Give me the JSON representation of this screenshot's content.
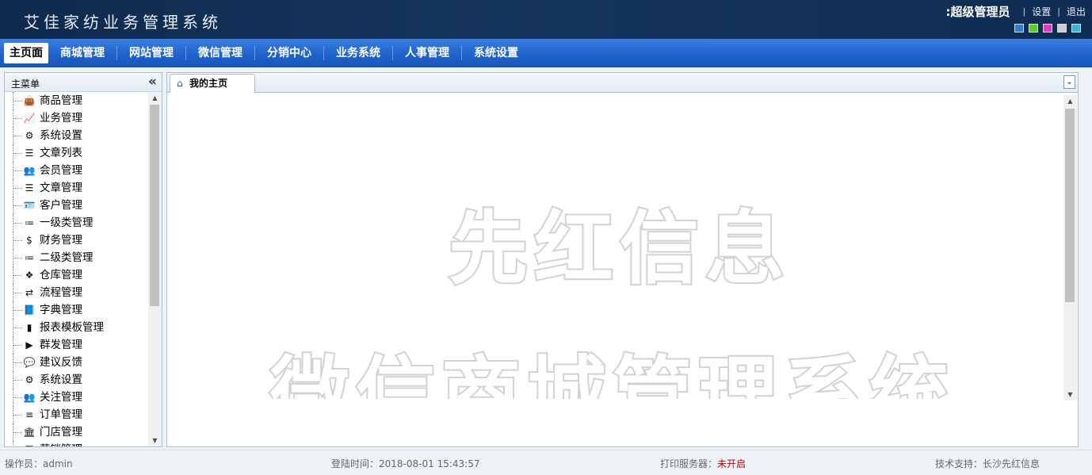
{
  "header": {
    "app_title": "艾佳家纺业务管理系统",
    "user_name": ":超级管理员",
    "settings_label": "设置",
    "logout_label": "退出",
    "theme_swatches": [
      "#2f7fd6",
      "#5ccf25",
      "#e23ac6",
      "#cccccc",
      "#35b4e6"
    ]
  },
  "nav": {
    "items": [
      {
        "label": "主页面",
        "active": true
      },
      {
        "label": "商城管理"
      },
      {
        "label": "网站管理"
      },
      {
        "label": "微信管理"
      },
      {
        "label": "分销中心"
      },
      {
        "label": "业务系统"
      },
      {
        "label": "人事管理"
      },
      {
        "label": "系统设置"
      }
    ]
  },
  "sidebar": {
    "title": "主菜单",
    "collapse_icon": "«",
    "items": [
      {
        "label": "商品管理",
        "icon": "shopping-bag-icon",
        "glyph": "👜"
      },
      {
        "label": "业务管理",
        "icon": "line-chart-icon",
        "glyph": "📈"
      },
      {
        "label": "系统设置",
        "icon": "gear-icon",
        "glyph": "⚙"
      },
      {
        "label": "文章列表",
        "icon": "list-icon",
        "glyph": "☰"
      },
      {
        "label": "会员管理",
        "icon": "users-icon",
        "glyph": "👥"
      },
      {
        "label": "文章管理",
        "icon": "list-icon",
        "glyph": "☰"
      },
      {
        "label": "客户管理",
        "icon": "id-card-icon",
        "glyph": "🪪"
      },
      {
        "label": "一级类管理",
        "icon": "ordered-list-icon",
        "glyph": "≔"
      },
      {
        "label": "财务管理",
        "icon": "dollar-icon",
        "glyph": "$"
      },
      {
        "label": "二级类管理",
        "icon": "ordered-list-icon",
        "glyph": "≔"
      },
      {
        "label": "仓库管理",
        "icon": "cubes-icon",
        "glyph": "❖"
      },
      {
        "label": "流程管理",
        "icon": "exchange-icon",
        "glyph": "⇄"
      },
      {
        "label": "字典管理",
        "icon": "book-icon",
        "glyph": "📘"
      },
      {
        "label": "报表模板管理",
        "icon": "file-icon",
        "glyph": "▮"
      },
      {
        "label": "群发管理",
        "icon": "play-icon",
        "glyph": "▶"
      },
      {
        "label": "建议反馈",
        "icon": "comment-icon",
        "glyph": "💬"
      },
      {
        "label": "系统设置",
        "icon": "gear-icon",
        "glyph": "⚙"
      },
      {
        "label": "关注管理",
        "icon": "users-icon",
        "glyph": "👥"
      },
      {
        "label": "订单管理",
        "icon": "bars-icon",
        "glyph": "≡"
      },
      {
        "label": "门店管理",
        "icon": "bank-icon",
        "glyph": "🏛"
      },
      {
        "label": "营销管理",
        "icon": "list-icon",
        "glyph": "☰"
      }
    ]
  },
  "main": {
    "tab_label": "我的主页",
    "tab_icon": "⌂",
    "tab_menu_icon": "⌄",
    "watermark_line1": "先红信息",
    "watermark_line2": "微信商城管理系统"
  },
  "footer": {
    "operator_label": "操作员：",
    "operator_value": "admin",
    "login_time_label": "登陆时间：",
    "login_time_value": "2018-08-01 15:43:57",
    "print_server_label": "打印服务器：",
    "print_server_value": "未开启",
    "support_label": "技术支持：",
    "support_value": "长沙先红信息"
  }
}
